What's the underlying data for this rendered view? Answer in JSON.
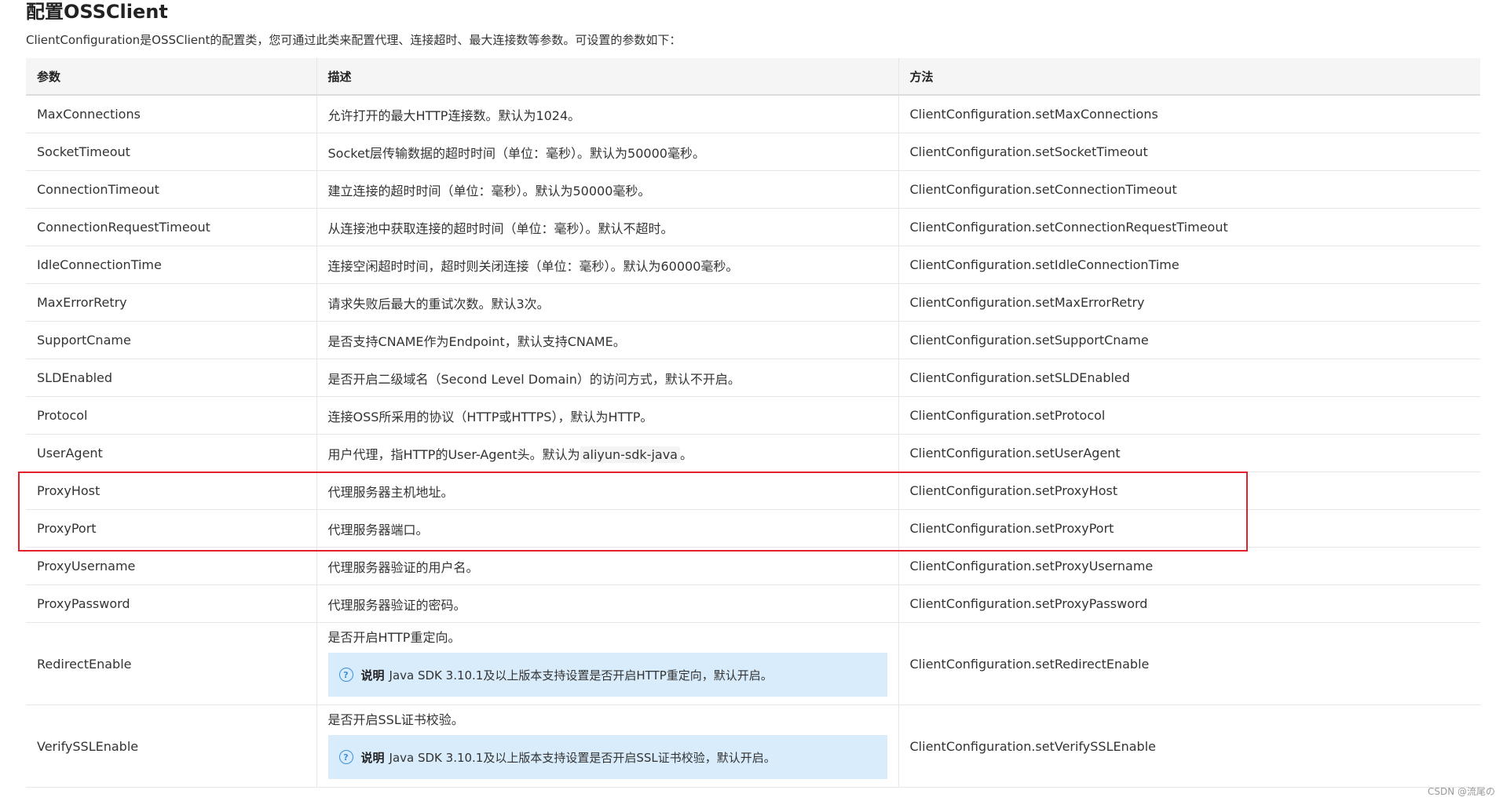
{
  "title": "配置OSSClient",
  "intro": "ClientConfiguration是OSSClient的配置类，您可通过此类来配置代理、连接超时、最大连接数等参数。可设置的参数如下：",
  "headers": {
    "param": "参数",
    "desc": "描述",
    "method": "方法"
  },
  "rows": [
    {
      "param": "MaxConnections",
      "desc": "允许打开的最大HTTP连接数。默认为1024。",
      "method": "ClientConfiguration.setMaxConnections"
    },
    {
      "param": "SocketTimeout",
      "desc": "Socket层传输数据的超时时间（单位：毫秒）。默认为50000毫秒。",
      "method": "ClientConfiguration.setSocketTimeout"
    },
    {
      "param": "ConnectionTimeout",
      "desc": "建立连接的超时时间（单位：毫秒）。默认为50000毫秒。",
      "method": "ClientConfiguration.setConnectionTimeout"
    },
    {
      "param": "ConnectionRequestTimeout",
      "desc": "从连接池中获取连接的超时时间（单位：毫秒）。默认不超时。",
      "method": "ClientConfiguration.setConnectionRequestTimeout"
    },
    {
      "param": "IdleConnectionTime",
      "desc": "连接空闲超时时间，超时则关闭连接（单位：毫秒）。默认为60000毫秒。",
      "method": "ClientConfiguration.setIdleConnectionTime"
    },
    {
      "param": "MaxErrorRetry",
      "desc": "请求失败后最大的重试次数。默认3次。",
      "method": "ClientConfiguration.setMaxErrorRetry"
    },
    {
      "param": "SupportCname",
      "desc": "是否支持CNAME作为Endpoint，默认支持CNAME。",
      "method": "ClientConfiguration.setSupportCname"
    },
    {
      "param": "SLDEnabled",
      "desc": "是否开启二级域名（Second Level Domain）的访问方式，默认不开启。",
      "method": "ClientConfiguration.setSLDEnabled"
    },
    {
      "param": "Protocol",
      "desc": "连接OSS所采用的协议（HTTP或HTTPS），默认为HTTP。",
      "method": "ClientConfiguration.setProtocol"
    },
    {
      "param": "UserAgent",
      "desc_prefix": "用户代理，指HTTP的User-Agent头。默认为",
      "desc_code": "aliyun-sdk-java",
      "desc_suffix": "。",
      "method": "ClientConfiguration.setUserAgent"
    },
    {
      "param": "ProxyHost",
      "desc": "代理服务器主机地址。",
      "method": "ClientConfiguration.setProxyHost"
    },
    {
      "param": "ProxyPort",
      "desc": "代理服务器端口。",
      "method": "ClientConfiguration.setProxyPort"
    },
    {
      "param": "ProxyUsername",
      "desc": "代理服务器验证的用户名。",
      "method": "ClientConfiguration.setProxyUsername"
    },
    {
      "param": "ProxyPassword",
      "desc": "代理服务器验证的密码。",
      "method": "ClientConfiguration.setProxyPassword"
    },
    {
      "param": "RedirectEnable",
      "desc": "是否开启HTTP重定向。",
      "note_label": "说明",
      "note_text": "Java SDK 3.10.1及以上版本支持设置是否开启HTTP重定向，默认开启。",
      "method": "ClientConfiguration.setRedirectEnable"
    },
    {
      "param": "VerifySSLEnable",
      "desc": "是否开启SSL证书校验。",
      "note_label": "说明",
      "note_text": "Java SDK 3.10.1及以上版本支持设置是否开启SSL证书校验，默认开启。",
      "method": "ClientConfiguration.setVerifySSLEnable"
    }
  ],
  "note_icon": "?",
  "watermark": "CSDN @流尾の",
  "colors": {
    "highlight": "#e3202d",
    "note_bg": "#d9ecfb",
    "header_bg": "#f5f5f5"
  }
}
